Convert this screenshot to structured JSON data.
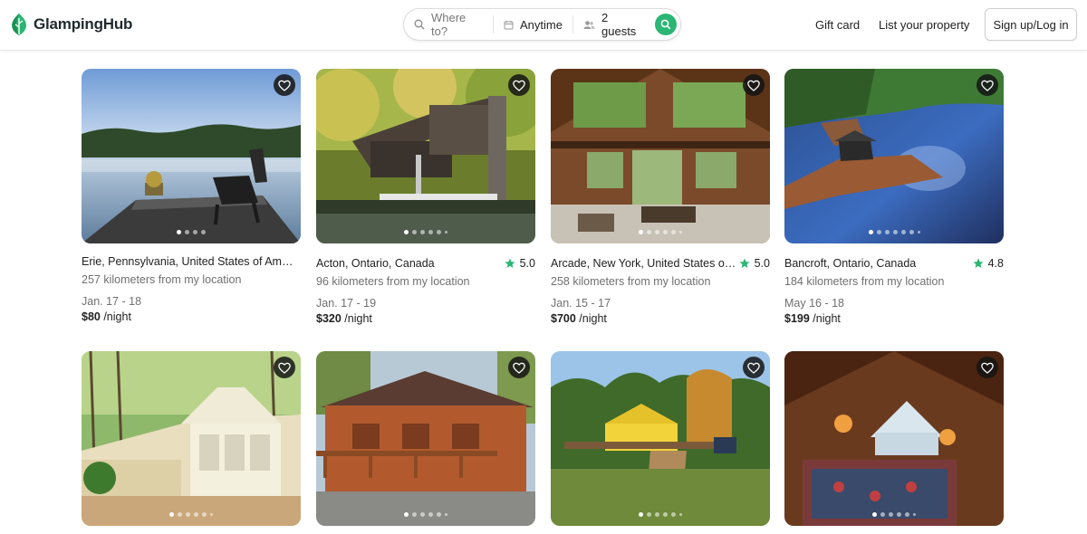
{
  "brand": {
    "name": "GlampingHub"
  },
  "search": {
    "where_placeholder": "Where to?",
    "when_value": "Anytime",
    "guests_value": "2 guests"
  },
  "nav": {
    "gift_card": "Gift card",
    "list_property": "List your property",
    "signup": "Sign up/Log in"
  },
  "colors": {
    "accent": "#2bb673",
    "star": "#2bb673",
    "heart_bg": "#1a1a1a"
  },
  "listings": [
    {
      "title": "Erie, Pennsylvania, United States of America",
      "rating": "",
      "distance": "257 kilometers from my location",
      "dates": "Jan. 17 - 18",
      "price": "$80",
      "per": " /night"
    },
    {
      "title": "Acton, Ontario, Canada",
      "rating": "5.0",
      "distance": "96 kilometers from my location",
      "dates": "Jan. 17 - 19",
      "price": "$320",
      "per": " /night"
    },
    {
      "title": "Arcade, New York, United States of ...",
      "rating": "5.0",
      "distance": "258 kilometers from my location",
      "dates": "Jan. 15 - 17",
      "price": "$700",
      "per": " /night"
    },
    {
      "title": "Bancroft, Ontario, Canada",
      "rating": "4.8",
      "distance": "184 kilometers from my location",
      "dates": "May 16 - 18",
      "price": "$199",
      "per": " /night"
    }
  ]
}
